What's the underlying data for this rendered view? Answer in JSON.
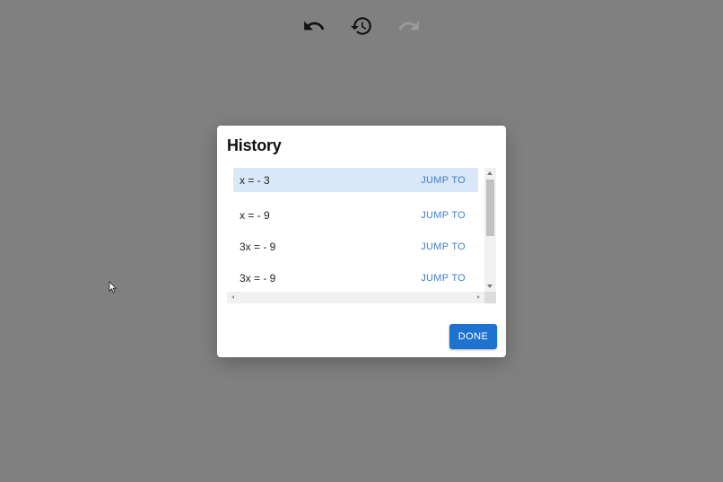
{
  "toolbar": {
    "undo_icon": "undo-icon",
    "history_icon": "history-icon",
    "redo_icon": "redo-icon"
  },
  "dialog": {
    "title": "History",
    "rows": [
      {
        "label": "x = - 3",
        "action": "JUMP TO",
        "active": true
      },
      {
        "label": "x = - 9",
        "action": "JUMP TO",
        "active": false
      },
      {
        "label": "3x = - 9",
        "action": "JUMP TO",
        "active": false
      },
      {
        "label": "3x = - 9",
        "action": "JUMP TO",
        "active": false
      }
    ],
    "done_label": "DONE"
  },
  "colors": {
    "backdrop": "#808080",
    "active_row": "#d9e7f6",
    "link": "#3f7fc8",
    "primary_button": "#1e73d0",
    "redo_disabled": "#9a9a9a"
  }
}
